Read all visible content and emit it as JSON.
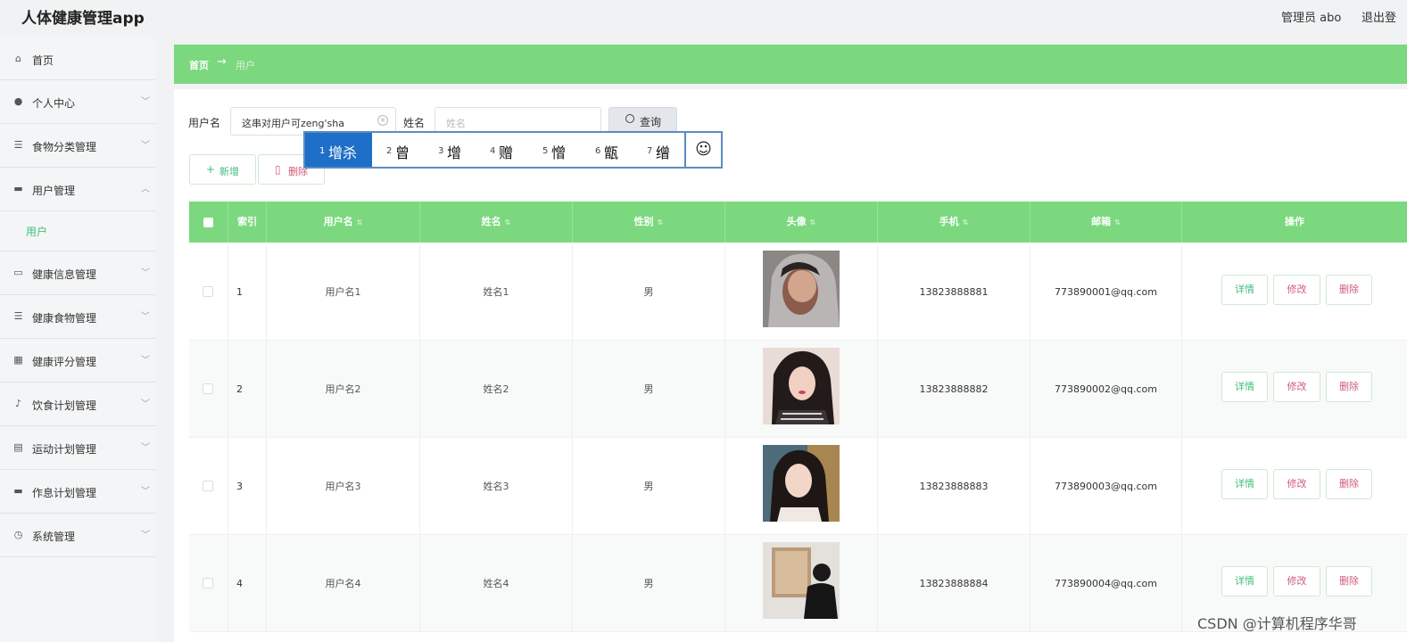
{
  "app": {
    "title": "人体健康管理app",
    "admin": "管理员 abo",
    "logout": "退出登"
  },
  "sidebar": {
    "items": [
      {
        "label": "首页",
        "icon": "home-icon",
        "glyph": "⌂",
        "arrow": ""
      },
      {
        "label": "个人中心",
        "icon": "user-icon",
        "glyph": "●",
        "arrow": "﹀"
      },
      {
        "label": "食物分类管理",
        "icon": "sliders-icon",
        "glyph": "☰",
        "arrow": "﹀"
      },
      {
        "label": "用户管理",
        "icon": "users-icon",
        "glyph": "▬",
        "arrow": "︿"
      },
      {
        "label": "健康信息管理",
        "icon": "card-icon",
        "glyph": "▭",
        "arrow": "﹀"
      },
      {
        "label": "健康食物管理",
        "icon": "list-icon",
        "glyph": "☰",
        "arrow": "﹀"
      },
      {
        "label": "健康评分管理",
        "icon": "chart-icon",
        "glyph": "▦",
        "arrow": "﹀"
      },
      {
        "label": "饮食计划管理",
        "icon": "mic-icon",
        "glyph": "♪",
        "arrow": "﹀"
      },
      {
        "label": "运动计划管理",
        "icon": "clipboard-icon",
        "glyph": "▤",
        "arrow": "﹀"
      },
      {
        "label": "作息计划管理",
        "icon": "comment-icon",
        "glyph": "▬",
        "arrow": "﹀"
      },
      {
        "label": "系统管理",
        "icon": "clock-icon",
        "glyph": "◷",
        "arrow": "﹀"
      }
    ],
    "submenu_active": "用户"
  },
  "breadcrumb": {
    "home": "首页",
    "current": "用户"
  },
  "search": {
    "username_label": "用户名",
    "username_value": "这串对用户可zeng'sha",
    "name_label": "姓名",
    "name_placeholder": "姓名",
    "button_label": "查询"
  },
  "toolbar": {
    "add_label": "新增",
    "delete_label": "删除"
  },
  "ime": {
    "candidates": [
      {
        "num": "1",
        "text": "增杀"
      },
      {
        "num": "2",
        "text": "曾"
      },
      {
        "num": "3",
        "text": "增"
      },
      {
        "num": "4",
        "text": "赠"
      },
      {
        "num": "5",
        "text": "憎"
      },
      {
        "num": "6",
        "text": "甑"
      },
      {
        "num": "7",
        "text": "缯"
      }
    ],
    "emoji": "☺"
  },
  "table": {
    "headers": [
      "索引",
      "用户名",
      "姓名",
      "性别",
      "头像",
      "手机",
      "邮箱",
      "操作"
    ],
    "rows": [
      {
        "index": "1",
        "username": "用户名1",
        "name": "姓名1",
        "gender": "男",
        "phone": "13823888881",
        "email": "773890001@qq.com"
      },
      {
        "index": "2",
        "username": "用户名2",
        "name": "姓名2",
        "gender": "男",
        "phone": "13823888882",
        "email": "773890002@qq.com"
      },
      {
        "index": "3",
        "username": "用户名3",
        "name": "姓名3",
        "gender": "男",
        "phone": "13823888883",
        "email": "773890003@qq.com"
      },
      {
        "index": "4",
        "username": "用户名4",
        "name": "姓名4",
        "gender": "男",
        "phone": "13823888884",
        "email": "773890004@qq.com"
      }
    ],
    "actions": {
      "detail": "详情",
      "edit": "修改",
      "delete": "删除"
    }
  },
  "colors": {
    "accent": "#7bd87e",
    "link": "#3dbf7c",
    "danger": "#d05b7a",
    "ime_select": "#1e6fc8"
  },
  "watermark": "CSDN @计算机程序华哥"
}
